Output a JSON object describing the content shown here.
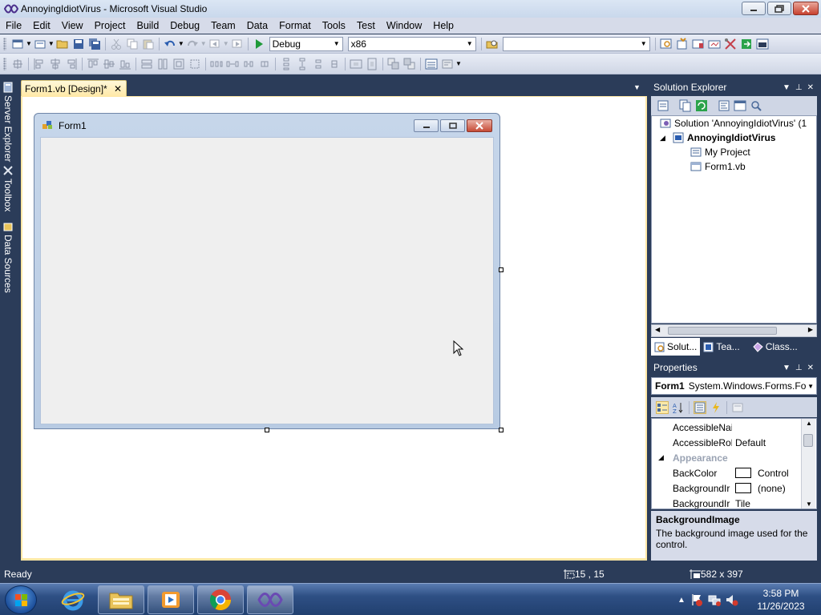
{
  "window": {
    "title": "AnnoyingIdiotVirus - Microsoft Visual Studio"
  },
  "menu": [
    "File",
    "Edit",
    "View",
    "Project",
    "Build",
    "Debug",
    "Team",
    "Data",
    "Format",
    "Tools",
    "Test",
    "Window",
    "Help"
  ],
  "toolbar": {
    "config_value": "Debug",
    "platform_value": "x86",
    "find_value": ""
  },
  "left_tabs": [
    "Server Explorer",
    "Toolbox",
    "Data Sources"
  ],
  "document_tab": {
    "label": "Form1.vb [Design]*",
    "close": "✕"
  },
  "form": {
    "title": "Form1"
  },
  "solution_explorer": {
    "title": "Solution Explorer",
    "items": [
      {
        "label": "Solution 'AnnoyingIdiotVirus' (1"
      },
      {
        "label": "AnnoyingIdiotVirus"
      },
      {
        "label": "My Project"
      },
      {
        "label": "Form1.vb"
      }
    ],
    "tabs": [
      "Solut...",
      "Tea...",
      "Class..."
    ]
  },
  "properties": {
    "title": "Properties",
    "object_name": "Form1",
    "object_type": "System.Windows.Forms.Fo",
    "rows": [
      {
        "name": "AccessibleNai",
        "value": ""
      },
      {
        "name": "AccessibleRol",
        "value": "Default"
      },
      {
        "name": "Appearance",
        "value": ""
      },
      {
        "name": "BackColor",
        "value": "Control"
      },
      {
        "name": "BackgroundIr",
        "value": "(none)"
      },
      {
        "name": "BackgroundIr",
        "value": "Tile"
      }
    ],
    "desc_title": "BackgroundImage",
    "desc_text": "The background image used for the control."
  },
  "status": {
    "ready": "Ready",
    "position": "15 , 15",
    "size": "582 x 397"
  },
  "clock": {
    "time": "3:58 PM",
    "date": "11/26/2023"
  },
  "colors": {
    "ide_dark": "#2b3c59",
    "tab_yellow": "#ffe8a6",
    "form_client": "#efefef"
  }
}
